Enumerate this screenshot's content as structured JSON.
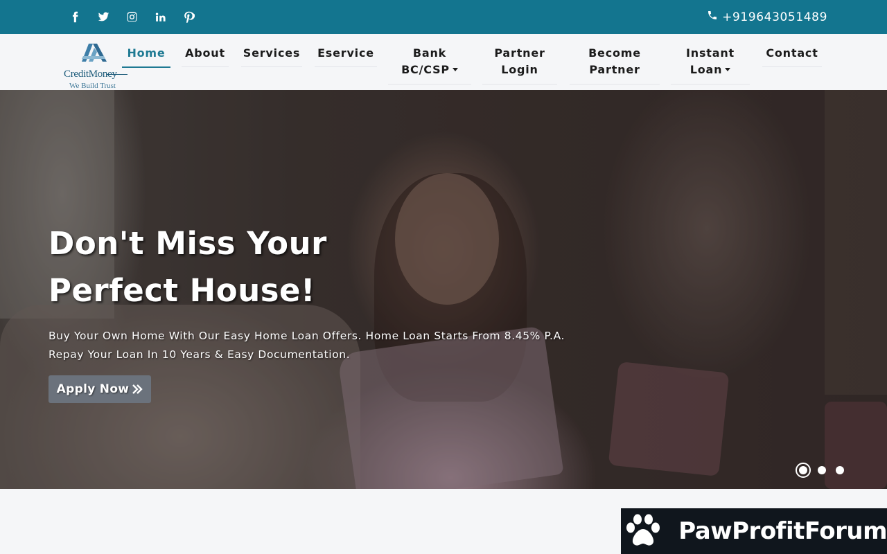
{
  "topbar": {
    "social": [
      {
        "icon": "facebook-icon"
      },
      {
        "icon": "twitter-icon"
      },
      {
        "icon": "instagram-icon"
      },
      {
        "icon": "linkedin-icon"
      },
      {
        "icon": "pinterest-icon"
      }
    ],
    "phone": "+919643051489",
    "bg_color": "#13758f"
  },
  "logo": {
    "name": "CreditMoney",
    "tagline": "We Build Trust"
  },
  "nav": {
    "items": [
      {
        "line1": "Home",
        "line2": ""
      },
      {
        "line1": "About",
        "line2": ""
      },
      {
        "line1": "Services",
        "line2": ""
      },
      {
        "line1": "Eservice",
        "line2": ""
      },
      {
        "line1": "Bank",
        "line2": "BC/CSP"
      },
      {
        "line1": "Partner",
        "line2": "Login"
      },
      {
        "line1": "Become",
        "line2": "Partner"
      },
      {
        "line1": "Instant",
        "line2": "Loan"
      },
      {
        "line1": "Contact",
        "line2": ""
      }
    ],
    "active_color": "#1f7a93"
  },
  "hero": {
    "title": "Don't Miss Your Perfect House!",
    "subtitle_line1": "Buy Your Own Home With Our Easy Home Loan Offers. Home Loan Starts From 8.45% P.A.",
    "subtitle_line2": "Repay Your Loan In 10 Years & Easy Documentation.",
    "button_label": "Apply Now",
    "button_icon": "double-chevron-right-icon",
    "slides": 3,
    "active_slide": 1
  },
  "watermark": {
    "text": "PawProfitForum",
    "icon": "paw-icon"
  }
}
